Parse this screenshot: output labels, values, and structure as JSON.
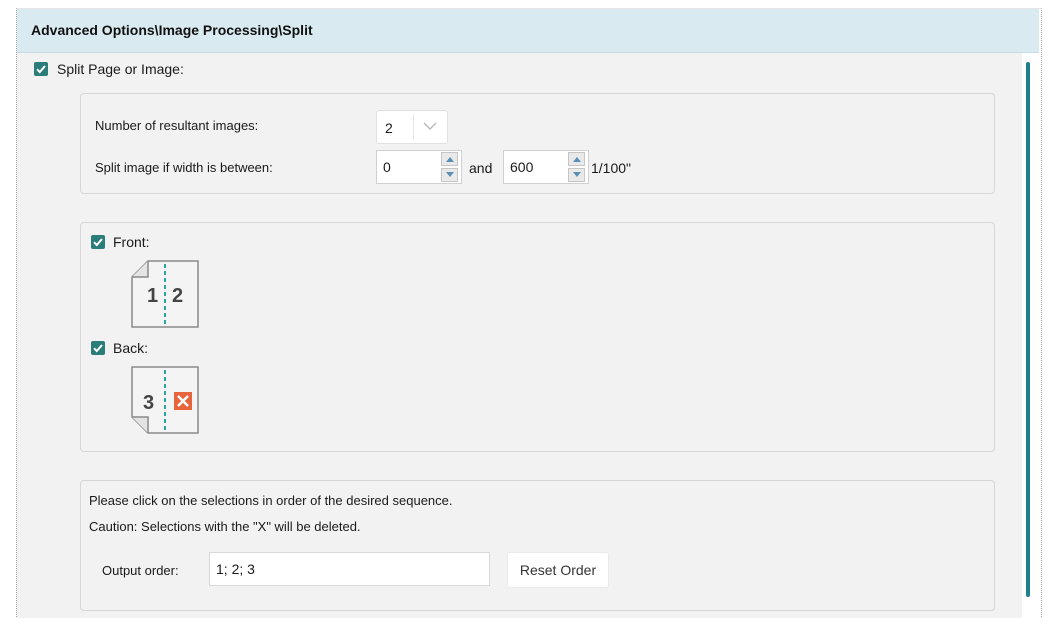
{
  "header": {
    "title": "Advanced Options\\Image Processing\\Split"
  },
  "split": {
    "label": "Split Page or Image:",
    "checked": true
  },
  "settings": {
    "resultant_label": "Number of resultant images:",
    "resultant_value": "2",
    "width_label": "Split image if width is between:",
    "min_value": "0",
    "and_label": "and",
    "max_value": "600",
    "unit_label": "1/100\""
  },
  "sides": {
    "front_label": "Front:",
    "front_checked": true,
    "front_pages": [
      "1",
      "2"
    ],
    "back_label": "Back:",
    "back_checked": true,
    "back_pages": [
      "3"
    ]
  },
  "order": {
    "instruction": "Please click on the selections in order of the desired sequence.",
    "caution": "Caution: Selections with the \"X\" will be deleted.",
    "output_label": "Output order:",
    "output_value": "1; 2; 3",
    "reset_label": "Reset Order"
  },
  "colors": {
    "header_bg": "#d9ebf0",
    "accent": "#2b7d7a",
    "scrollbar": "#1c7f8a",
    "delete_mark": "#e8643c"
  }
}
